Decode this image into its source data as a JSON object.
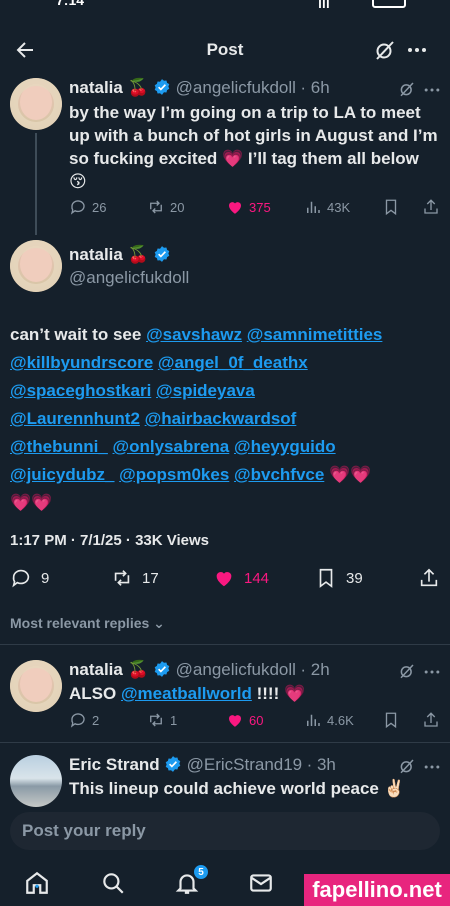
{
  "status_bar": {
    "time": "7:14",
    "signal_text": "|||"
  },
  "header": {
    "title": "Post"
  },
  "parent_post": {
    "name": "natalia 🍒",
    "handle": "@angelicfukdoll",
    "time": "· 6h",
    "text": "by the way I’m going on a trip to LA to meet up with a bunch of hot girls in August and I’m so fucking excited 💗 I’ll tag them all below 😚",
    "replies": "26",
    "reposts": "20",
    "likes": "375",
    "views": "43K"
  },
  "main_post": {
    "name": "natalia 🍒",
    "handle": "@angelicfukdoll",
    "text_intro": "can’t wait to see",
    "mentions": [
      "@savshawz",
      "@samnimetitties",
      "@killbyundrscore",
      "@angel_0f_deathx",
      "@spaceghostkari",
      "@spideyava",
      "@Laurennhunt2",
      "@hairbackwardsof",
      "@thebunni_",
      "@onlysabrena",
      "@heyyguido",
      "@juicydubz_",
      "@popsm0kes",
      "@bvchfvce"
    ],
    "hearts_line1": "💗💗",
    "hearts_line2": "💗💗",
    "timestamp": "1:17 PM · 7/1/25 ·",
    "views_count": "33K",
    "views_label": "Views",
    "replies": "9",
    "reposts": "17",
    "likes": "144",
    "bookmarks": "39"
  },
  "replies_filter": {
    "label": "Most relevant replies"
  },
  "reply_1": {
    "name": "natalia 🍒",
    "handle": "@angelicfukdoll",
    "time": "· 2h",
    "text_intro": "ALSO",
    "mention": "@meatballworld",
    "text_outro": "!!!! 💗",
    "replies": "2",
    "reposts": "1",
    "likes": "60",
    "views": "4.6K"
  },
  "reply_2": {
    "name": "Eric Strand",
    "handle": "@EricStrand19",
    "time": "· 3h",
    "text": "This lineup could achieve world peace ✌🏻"
  },
  "reply_box": {
    "placeholder": "Post your reply"
  },
  "nav": {
    "notification_count": "5"
  },
  "watermark": {
    "text": "fapellino.net"
  },
  "colors": {
    "background": "#15202b",
    "accent": "#1d9bf0",
    "like": "#f91880",
    "muted": "#8b98a5"
  }
}
